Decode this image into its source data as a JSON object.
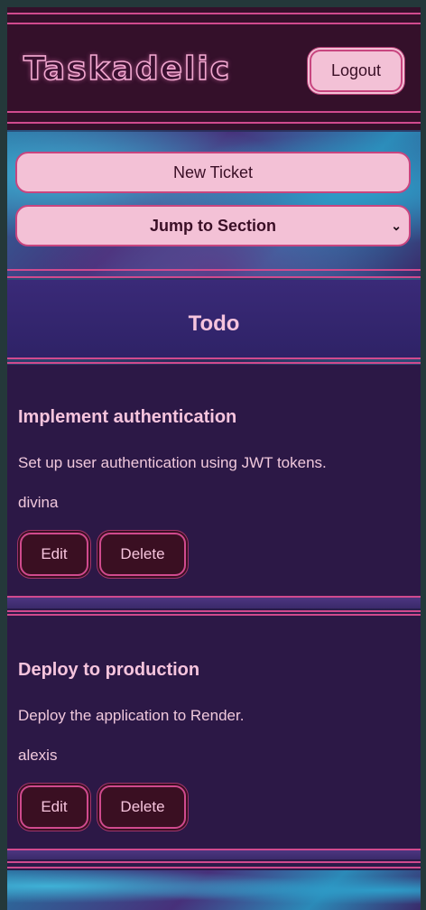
{
  "header": {
    "logo": "Taskadelic",
    "logout_label": "Logout"
  },
  "actions": {
    "new_ticket_label": "New Ticket",
    "jump_label": "Jump to Section"
  },
  "section": {
    "title": "Todo",
    "tickets": [
      {
        "title": "Implement authentication",
        "description": "Set up user authentication using JWT tokens.",
        "assignee": "divina",
        "edit_label": "Edit",
        "delete_label": "Delete"
      },
      {
        "title": "Deploy to production",
        "description": "Deploy the application to Render.",
        "assignee": "alexis",
        "edit_label": "Edit",
        "delete_label": "Delete"
      }
    ]
  },
  "colors": {
    "accent_pink": "#d04a8e",
    "pill_bg": "#f3c1d6",
    "header_bg": "#34102a",
    "card_bg": "#2c1846"
  }
}
